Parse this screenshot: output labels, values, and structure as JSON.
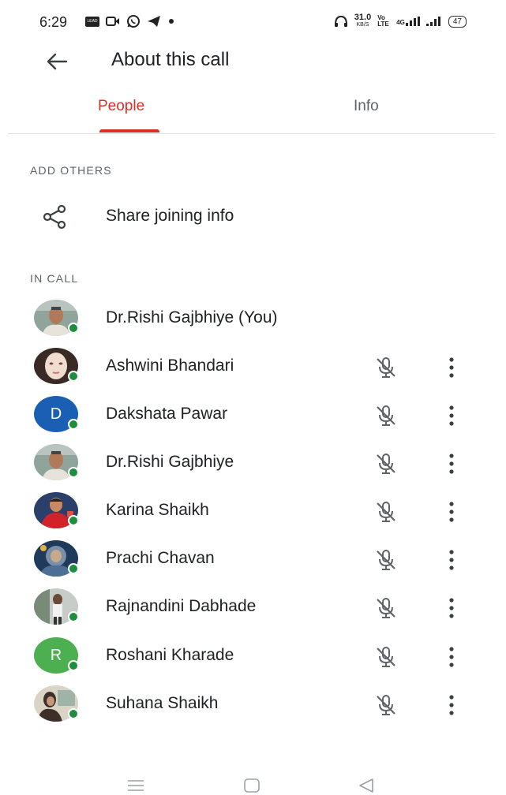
{
  "status_bar": {
    "time": "6:29",
    "left_icons": [
      "lead-icon",
      "video-call-icon",
      "whatsapp-icon",
      "telegram-icon",
      "dot-icon"
    ],
    "lead_text": "LEAD",
    "headphone_icon": "headphone-icon",
    "network_speed": "31.0",
    "network_speed_unit": "KB/S",
    "volte": "Vo LTE",
    "signal_label": "4G",
    "battery": "47"
  },
  "app_bar": {
    "title": "About this call",
    "back_icon": "arrow-left-icon"
  },
  "tabs": [
    {
      "label": "People",
      "selected": true
    },
    {
      "label": "Info",
      "selected": false
    }
  ],
  "colors": {
    "accent": "#d93025",
    "online": "#1e8e3e",
    "text_primary": "#202124",
    "text_secondary": "#5f6368",
    "avatar_blue": "#1a5fb4",
    "avatar_green": "#4caf50"
  },
  "add_others": {
    "section_label": "ADD OTHERS",
    "share_label": "Share joining info",
    "share_icon": "share-icon"
  },
  "in_call": {
    "section_label": "IN CALL",
    "participants": [
      {
        "name": "Dr.Rishi Gajbhiye (You)",
        "avatar": "photo",
        "muted_icon": false,
        "more": false
      },
      {
        "name": "Ashwini Bhandari",
        "avatar": "photo",
        "muted_icon": true,
        "more": true
      },
      {
        "name": "Dakshata Pawar",
        "avatar": "letter",
        "letter": "D",
        "avatar_color": "#1a5fb4",
        "muted_icon": true,
        "more": true
      },
      {
        "name": "Dr.Rishi Gajbhiye",
        "avatar": "photo",
        "muted_icon": true,
        "more": true
      },
      {
        "name": "Karina Shaikh",
        "avatar": "photo",
        "muted_icon": true,
        "more": true
      },
      {
        "name": "Prachi Chavan",
        "avatar": "photo",
        "muted_icon": true,
        "more": true
      },
      {
        "name": "Rajnandini Dabhade",
        "avatar": "photo",
        "muted_icon": true,
        "more": true
      },
      {
        "name": "Roshani Kharade",
        "avatar": "letter",
        "letter": "R",
        "avatar_color": "#4caf50",
        "muted_icon": true,
        "more": true
      },
      {
        "name": "Suhana Shaikh",
        "avatar": "photo",
        "muted_icon": true,
        "more": true
      }
    ]
  },
  "nav_bar": {
    "icons": [
      "menu-icon",
      "home-icon",
      "back-triangle-icon"
    ]
  }
}
